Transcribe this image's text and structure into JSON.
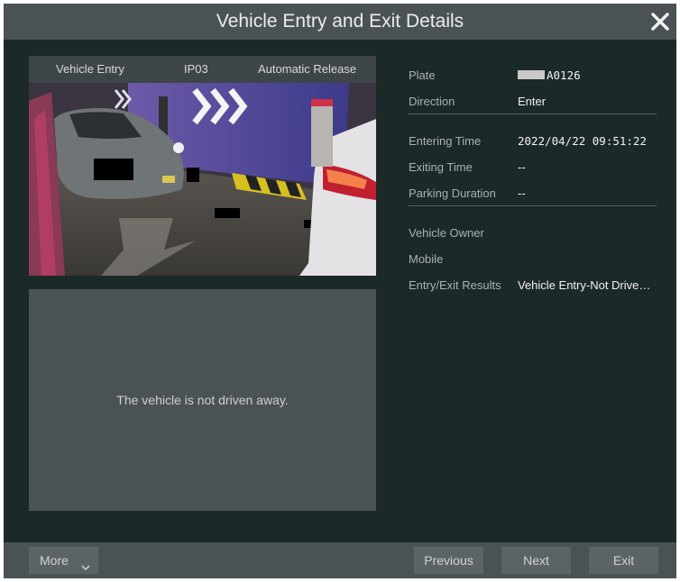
{
  "dialog": {
    "title": "Vehicle Entry and Exit Details",
    "close_icon": "close-icon"
  },
  "camera": {
    "event": "Vehicle Entry",
    "channel": "IP03",
    "release": "Automatic Release"
  },
  "exit_panel": {
    "message": "The vehicle is not driven away."
  },
  "details": {
    "plate": {
      "label": "Plate",
      "value": "A0126"
    },
    "direction": {
      "label": "Direction",
      "value": "Enter"
    },
    "entering_time": {
      "label": "Entering Time",
      "value": "2022/04/22 09:51:22"
    },
    "exiting_time": {
      "label": "Exiting Time",
      "value": "--"
    },
    "parking_duration": {
      "label": "Parking Duration",
      "value": "--"
    },
    "vehicle_owner": {
      "label": "Vehicle Owner",
      "value": ""
    },
    "mobile": {
      "label": "Mobile",
      "value": ""
    },
    "results": {
      "label": "Entry/Exit Results",
      "value": "Vehicle Entry-Not Drive…"
    }
  },
  "footer": {
    "more_label": "More",
    "previous_label": "Previous",
    "next_label": "Next",
    "exit_label": "Exit"
  },
  "colors": {
    "dialog_bg": "#1c2929",
    "bar_bg": "#4b5256",
    "button_bg": "#5c6366"
  }
}
